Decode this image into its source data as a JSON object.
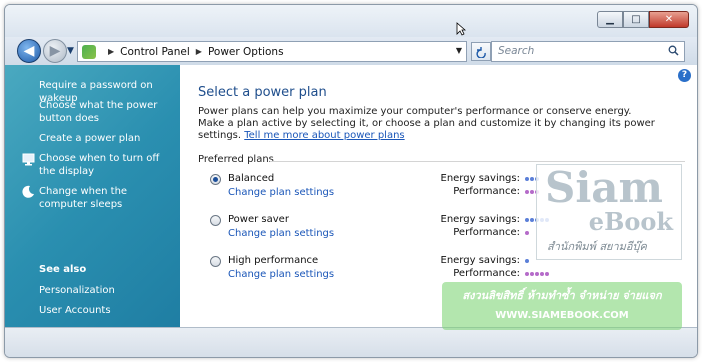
{
  "window": {
    "minimize_label": "▁",
    "maximize_label": "□",
    "close_label": "✕"
  },
  "nav": {
    "back_label": "◀",
    "forward_label": "▶",
    "breadcrumb": [
      "Control Panel",
      "Power Options"
    ],
    "search_placeholder": "Search"
  },
  "sidebar": {
    "items": [
      {
        "label": "Require a password on wakeup"
      },
      {
        "label": "Choose what the power button does"
      },
      {
        "label": "Create a power plan"
      },
      {
        "label": "Choose when to turn off the display",
        "icon": "monitor-icon"
      },
      {
        "label": "Change when the computer sleeps",
        "icon": "moon-icon"
      }
    ],
    "see_also": {
      "heading": "See also",
      "items": [
        {
          "label": "Personalization"
        },
        {
          "label": "User Accounts"
        }
      ]
    }
  },
  "main": {
    "title": "Select a power plan",
    "intro_text": "Power plans can help you maximize your computer's performance or conserve energy. Make a plan active by selecting it, or choose a plan and customize it by changing its power settings.",
    "intro_link": "Tell me more about power plans",
    "group_label": "Preferred plans",
    "energy_label": "Energy savings:",
    "performance_label": "Performance:",
    "plans": [
      {
        "name": "Balanced",
        "link": "Change plan settings",
        "selected": true,
        "energy_savings": 3,
        "performance": 3
      },
      {
        "name": "Power saver",
        "link": "Change plan settings",
        "selected": false,
        "energy_savings": 5,
        "performance": 1
      },
      {
        "name": "High performance",
        "link": "Change plan settings",
        "selected": false,
        "energy_savings": 1,
        "performance": 5
      }
    ]
  },
  "watermark": {
    "brand_top": "Siam",
    "brand_bottom": "eBook",
    "thai_name": "สำนักพิมพ์ สยามอีบุ๊ค",
    "slogan": "สงวนลิขสิทธิ์ ห้ามทำซ้ำ จำหน่าย จ่ายแจก",
    "url": "WWW.SIAMEBOOK.COM"
  },
  "colors": {
    "sidebar": "#2a8fb0",
    "link": "#1a56b8",
    "title": "#1f4e8c",
    "dot_energy": "#5b7fd8",
    "dot_performance": "#b56bc9"
  }
}
